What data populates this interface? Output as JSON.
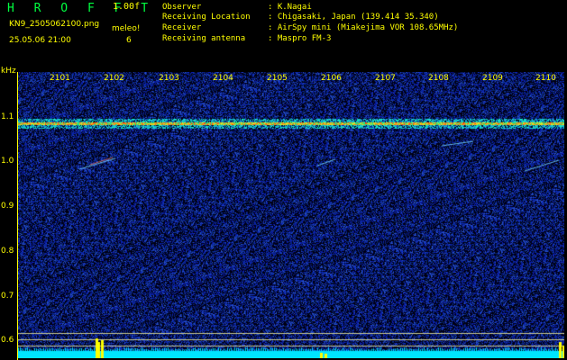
{
  "header": {
    "title": "H R O F F T",
    "version": "1.00f",
    "filename": "KN9_2505062100.png",
    "meleo_label": "meleo!",
    "datetime": "25.05.06 21:00",
    "count": "6"
  },
  "info": [
    {
      "key": "Observer",
      "value": ": K.Nagai"
    },
    {
      "key": "Receiving Location",
      "value": ": Chigasaki, Japan (139.414 35.340)"
    },
    {
      "key": "Receiver",
      "value": ": AirSpy mini (Miakejima VOR 108.65MHz)"
    },
    {
      "key": "Receiving antenna",
      "value": ": Maspro FM-3"
    }
  ],
  "axis": {
    "unit": "kHz",
    "y_labels": [
      "1.1",
      "1.0",
      "0.9",
      "0.8",
      "0.7",
      "0.6"
    ],
    "x_labels": [
      "2101",
      "2102",
      "2103",
      "2104",
      "2105",
      "2106",
      "2107",
      "2108",
      "2109",
      "2110"
    ]
  },
  "colors": {
    "text": "#ffff00",
    "title": "#00ff40",
    "background": "#000000",
    "noise": "#1a2a9a",
    "carrier": "#ff4020",
    "baseline": "#00e5ff"
  }
}
